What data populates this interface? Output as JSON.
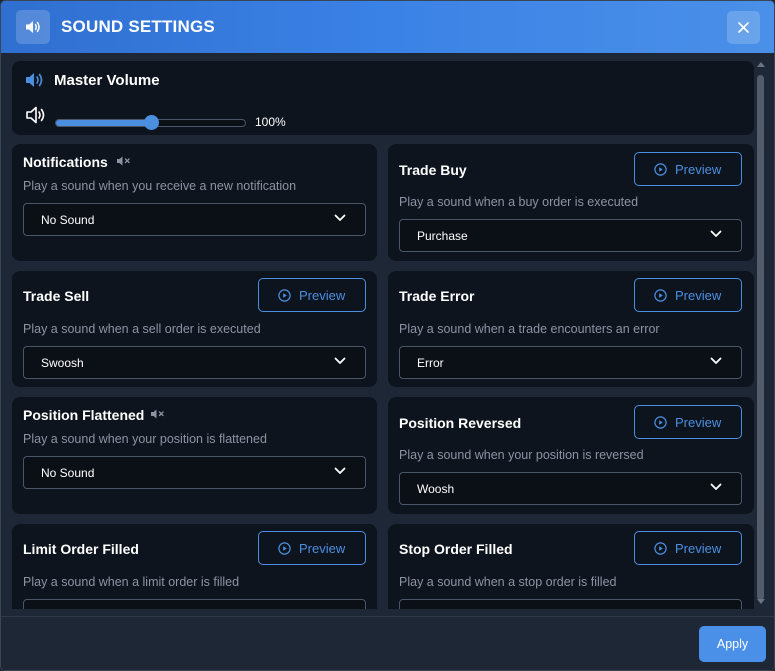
{
  "dialog": {
    "title": "SOUND SETTINGS",
    "icon": "speaker-icon",
    "close_icon": "close-icon"
  },
  "master": {
    "title": "Master Volume",
    "volume_percent": 100,
    "volume_fraction": 0.5,
    "volume_label": "100%"
  },
  "preview_label": "Preview",
  "sections": {
    "notifications": {
      "title": "Notifications",
      "desc": "Play a sound when you receive a new notification",
      "value": "No Sound",
      "muted": true
    },
    "trade_buy": {
      "title": "Trade Buy",
      "desc": "Play a sound when a buy order is executed",
      "value": "Purchase"
    },
    "trade_sell": {
      "title": "Trade Sell",
      "desc": "Play a sound when a sell order is executed",
      "value": "Swoosh"
    },
    "trade_error": {
      "title": "Trade Error",
      "desc": "Play a sound when a trade encounters an error",
      "value": "Error"
    },
    "position_flattened": {
      "title": "Position Flattened",
      "desc": "Play a sound when your position is flattened",
      "value": "No Sound",
      "muted": true
    },
    "position_reversed": {
      "title": "Position Reversed",
      "desc": "Play a sound when your position is reversed",
      "value": "Woosh"
    },
    "limit_order_filled": {
      "title": "Limit Order Filled",
      "desc": "Play a sound when a limit order is filled",
      "value": ""
    },
    "stop_order_filled": {
      "title": "Stop Order Filled",
      "desc": "Play a sound when a stop order is filled",
      "value": ""
    }
  },
  "footer": {
    "apply_label": "Apply"
  },
  "colors": {
    "accent": "#4a8fe0",
    "header_gradient_start": "#2f6fd0",
    "header_gradient_end": "#4a90e8",
    "card_bg": "#0e141e",
    "dialog_bg": "#1e2736",
    "muted_text": "#8b94a3"
  }
}
